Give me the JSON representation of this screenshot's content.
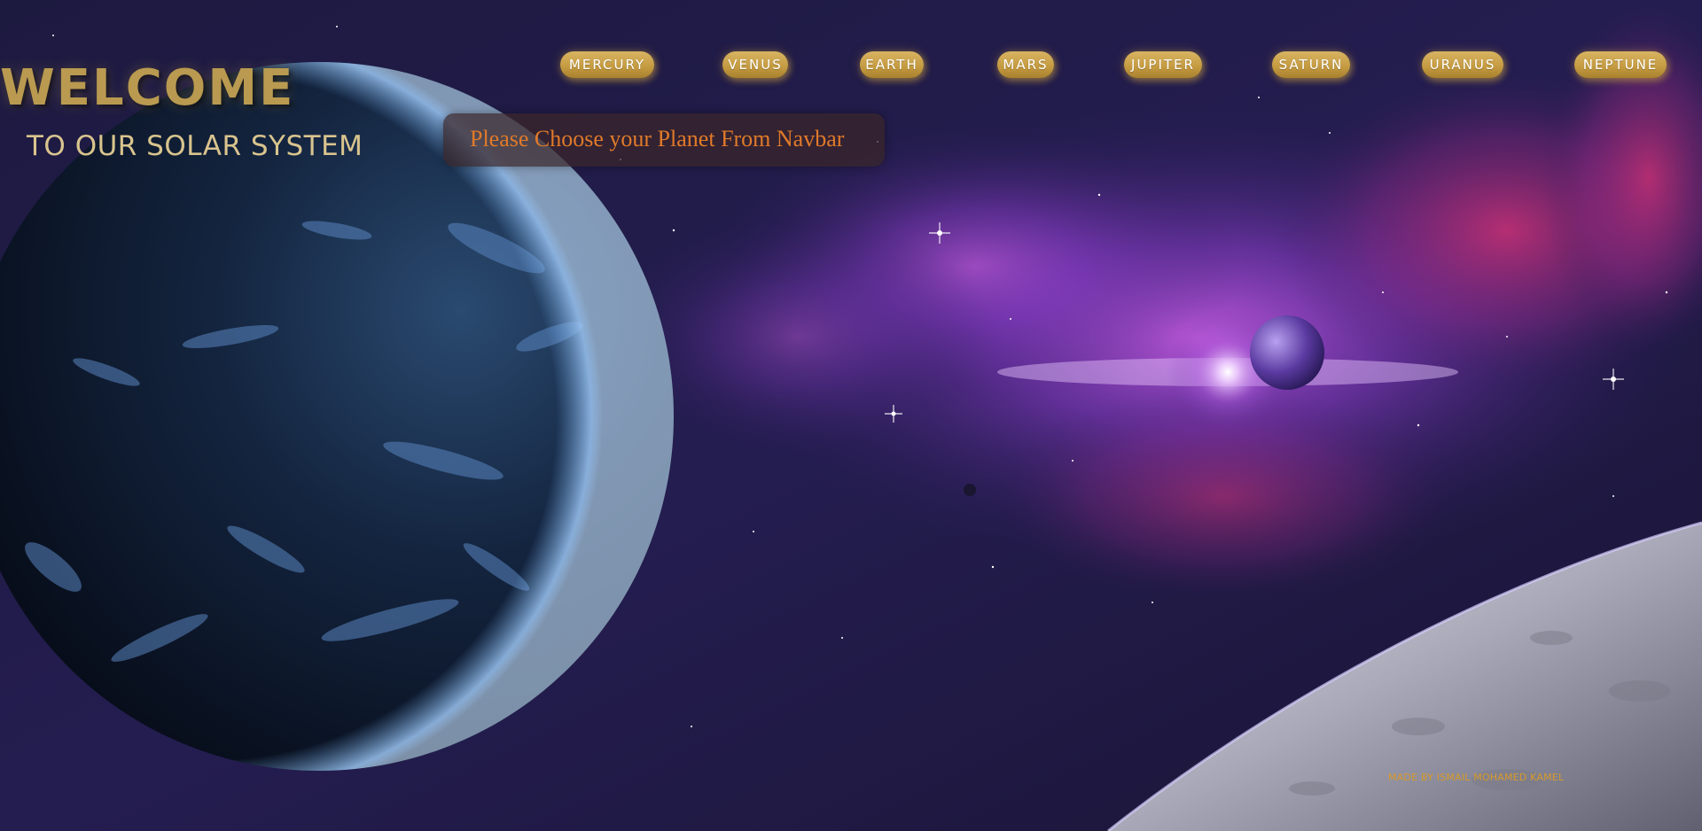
{
  "hero": {
    "welcome": "WELCOME",
    "subtitle": "TO OUR SOLAR SYSTEM"
  },
  "navbar": {
    "items": [
      {
        "label": "MERCURY"
      },
      {
        "label": "VENUS"
      },
      {
        "label": "EARTH"
      },
      {
        "label": "MARS"
      },
      {
        "label": "JUPITER"
      },
      {
        "label": "SATURN"
      },
      {
        "label": "URANUS"
      },
      {
        "label": "NEPTUNE"
      }
    ]
  },
  "prompt": {
    "text": "Please Choose your Planet From Navbar"
  },
  "footer": {
    "credit": "MADE BY ISMAIL MOHAMED KAMEL"
  },
  "colors": {
    "gold_accent": "#c49a40",
    "prompt_text": "#e07a2a",
    "footer_text": "#d79a2a",
    "background": "#1a1736"
  }
}
